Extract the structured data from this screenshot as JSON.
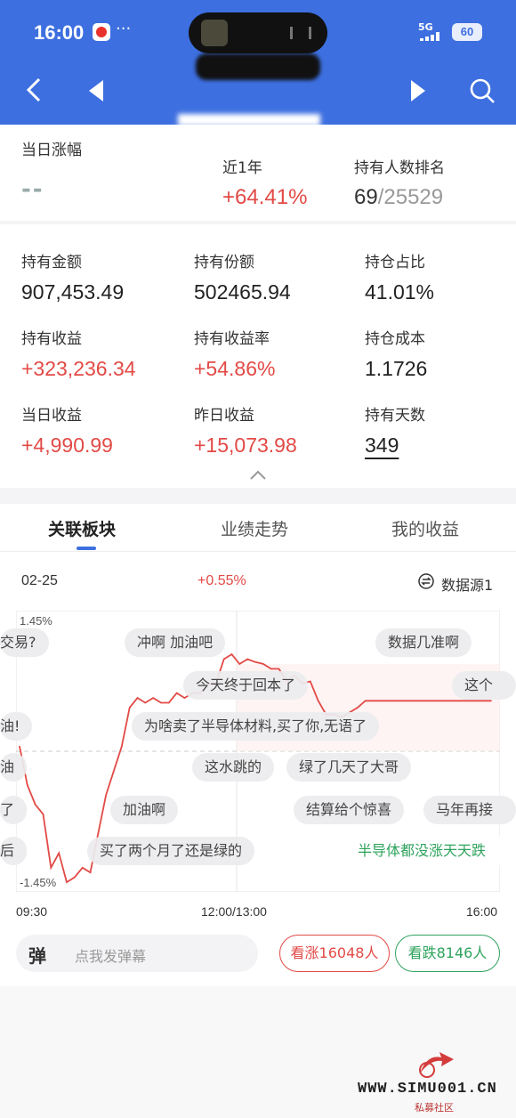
{
  "status_bar": {
    "time": "16:00",
    "dots": "···",
    "network": "5G",
    "battery": "60"
  },
  "summary": {
    "daily_change_label": "当日涨幅",
    "daily_change_value": "--",
    "year_label": "近1年",
    "year_value": "+64.41%",
    "rank_label": "持有人数排名",
    "rank_value": "69",
    "rank_total": "/25529"
  },
  "holdings": [
    {
      "label": "持有金额",
      "value": "907,453.49",
      "red": false
    },
    {
      "label": "持有份额",
      "value": "502465.94",
      "red": false
    },
    {
      "label": "持仓占比",
      "value": "41.01%",
      "red": false
    },
    {
      "label": "持有收益",
      "value": "+323,236.34",
      "red": true
    },
    {
      "label": "持有收益率",
      "value": "+54.86%",
      "red": true
    },
    {
      "label": "持仓成本",
      "value": "1.1726",
      "red": false
    },
    {
      "label": "当日收益",
      "value": "+4,990.99",
      "red": true
    },
    {
      "label": "昨日收益",
      "value": "+15,073.98",
      "red": true
    },
    {
      "label": "持有天数",
      "value": "349",
      "red": false
    }
  ],
  "tabs": [
    "关联板块",
    "业绩走势",
    "我的收益"
  ],
  "chart_header": {
    "date": "02-25",
    "change": "+0.55%",
    "source": "数据源1"
  },
  "danmaku": [
    "交易?",
    "冲啊 加油吧",
    "数据几准啊",
    "今天终于回本了",
    "这个",
    "油!",
    "为啥卖了半导体材料,买了你,无语了",
    "油",
    "这水跳的",
    "绿了几天了大哥",
    "了",
    "加油啊",
    "结算给个惊喜",
    "马年再接",
    "后",
    "买了两个月了还是绿的",
    "半导体都没涨天天跌"
  ],
  "bottom": {
    "danmu_badge": "弹",
    "danmu_placeholder": "点我发弹幕",
    "up_label": "看涨16048人",
    "down_label": "看跌8146人"
  },
  "watermark": {
    "site": "WWW.SIMU001.CN",
    "sub": "私募社区"
  },
  "colors": {
    "brand": "#3d6fe0",
    "up": "#e24a46",
    "down": "#2fa35d"
  },
  "chart_data": {
    "type": "line",
    "title": "",
    "xlabel": "",
    "ylabel": "",
    "x_ticks": [
      "09:30",
      "12:00/13:00",
      "16:00"
    ],
    "y_ticks": [
      "1.45%",
      "-1.45%"
    ],
    "ylim": [
      -1.45,
      1.45
    ],
    "series": [
      {
        "x": [
          0,
          4,
          8,
          12,
          16,
          20,
          24,
          28,
          32,
          36,
          40,
          44,
          48,
          52,
          56,
          60,
          64,
          68,
          72,
          76,
          80,
          84,
          88,
          92,
          96,
          100,
          104,
          108,
          112,
          116,
          120,
          124,
          128,
          132,
          136,
          140,
          144,
          148,
          152,
          156,
          160,
          164,
          168,
          172,
          176,
          180,
          184,
          188,
          192,
          196,
          200,
          204,
          208,
          212,
          216,
          220,
          224,
          228,
          232,
          236,
          240
        ],
        "values": [
          0.05,
          -0.35,
          -0.55,
          -0.65,
          -1.2,
          -1.05,
          -1.35,
          -1.3,
          -1.2,
          -1.25,
          -0.85,
          -0.45,
          -0.2,
          0.05,
          0.45,
          0.55,
          0.5,
          0.55,
          0.5,
          0.5,
          0.6,
          0.55,
          0.6,
          0.6,
          0.7,
          0.7,
          0.95,
          1.0,
          0.9,
          0.95,
          0.92,
          0.9,
          0.85,
          0.85,
          0.72,
          0.78,
          0.7,
          0.72,
          0.52,
          0.38,
          0.38,
          0.35,
          0.4,
          0.45,
          0.52,
          0.52,
          0.52,
          0.52,
          0.52,
          0.52,
          0.52,
          0.52,
          0.52,
          0.52,
          0.52,
          0.52,
          0.52,
          0.52,
          0.52,
          0.52,
          0.52
        ]
      }
    ],
    "grid": true
  }
}
